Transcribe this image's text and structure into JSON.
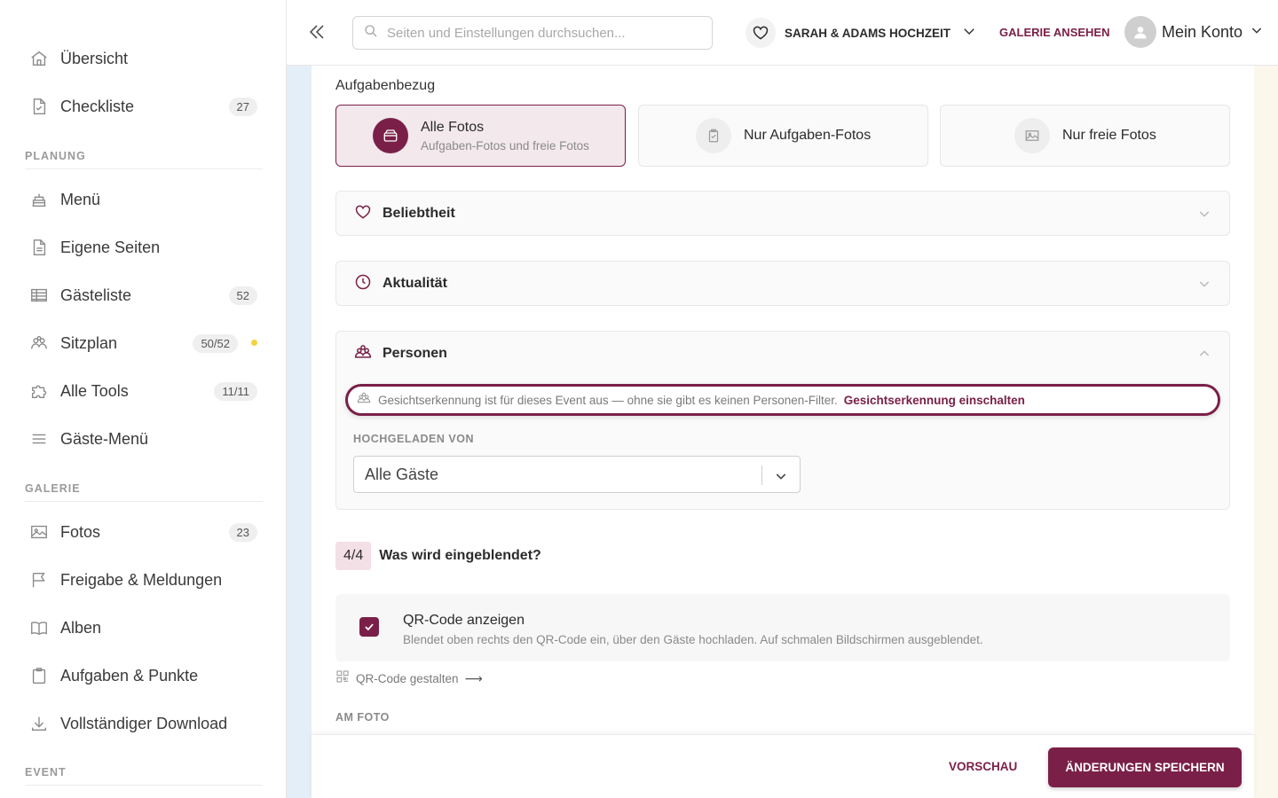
{
  "sidebar": {
    "items": [
      {
        "label": "Übersicht",
        "icon": "home-icon"
      },
      {
        "label": "Checkliste",
        "icon": "document-check-icon",
        "badge": "27"
      },
      {
        "label": "Menü",
        "icon": "cake-icon"
      },
      {
        "label": "Eigene Seiten",
        "icon": "document-icon"
      },
      {
        "label": "Gästeliste",
        "icon": "table-icon",
        "badge": "52"
      },
      {
        "label": "Sitzplan",
        "icon": "people-icon",
        "badge": "50/52"
      },
      {
        "label": "Alle Tools",
        "icon": "puzzle-icon",
        "badge": "11/11"
      },
      {
        "label": "Gäste-Menü",
        "icon": "menu-lines-icon"
      },
      {
        "label": "Fotos",
        "icon": "image-icon",
        "badge": "23"
      },
      {
        "label": "Freigabe & Meldungen",
        "icon": "flag-icon"
      },
      {
        "label": "Alben",
        "icon": "book-icon"
      },
      {
        "label": "Aufgaben & Punkte",
        "icon": "clipboard-icon"
      },
      {
        "label": "Vollständiger Download",
        "icon": "download-icon"
      }
    ],
    "sections": {
      "planung": "PLANUNG",
      "galerie": "GALERIE",
      "event": "EVENT"
    },
    "sitzplan_dot_color": "#f3d33b"
  },
  "header": {
    "search_placeholder": "Seiten und Einstellungen durchsuchen...",
    "event_name": "SARAH & ADAMS HOCHZEIT",
    "gallery_link": "GALERIE ANSEHEN",
    "account_label": "Mein Konto"
  },
  "main": {
    "section_title": "Aufgabenbezug",
    "segments": [
      {
        "title": "Alle Fotos",
        "subtitle": "Aufgaben-Fotos und freie Fotos",
        "active": true
      },
      {
        "title": "Nur Aufgaben-Fotos",
        "active": false
      },
      {
        "title": "Nur freie Fotos",
        "active": false
      }
    ],
    "accordions": {
      "beliebtheit": "Beliebtheit",
      "aktualitaet": "Aktualität",
      "personen": "Personen"
    },
    "face_notice": {
      "text": "Gesichtserkennung ist für dieses Event aus — ohne sie gibt es keinen Personen-Filter.",
      "link": "Gesichtserkennung einschalten"
    },
    "uploaded_by": {
      "label": "HOCHGELADEN VON",
      "value": "Alle Gäste"
    },
    "step": {
      "badge": "4/4",
      "title": "Was wird eingeblendet?"
    },
    "qr_option": {
      "title": "QR-Code anzeigen",
      "description": "Blendet oben rechts den QR-Code ein, über den Gäste hochladen. Auf schmalen Bildschirmen ausgeblendet.",
      "checked": true
    },
    "qr_design_link": "QR-Code gestalten",
    "qr_design_arrow": "⟶",
    "am_foto": "AM FOTO"
  },
  "footer": {
    "preview": "VORSCHAU",
    "save": "ÄNDERUNGEN SPEICHERN"
  },
  "colors": {
    "accent": "#7a2048",
    "accent_light": "#f3e8ec"
  }
}
